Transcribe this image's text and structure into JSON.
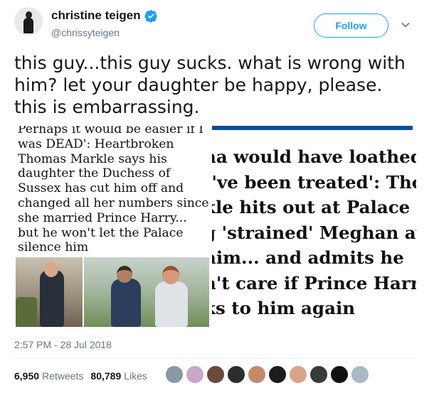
{
  "user": {
    "display_name": "christine teigen",
    "handle": "@chrissyteigen",
    "verified": true
  },
  "follow_label": "Follow",
  "tweet_text": "this guy...this guy sucks. what is wrong with him? let your daughter be happy, please. this is embarrassing.",
  "media": {
    "left_headline": "Perhaps it would be easier if I was DEAD': Heartbroken Thomas Markle says his daughter the Duchess of Sussex has cut him off and changed all her numbers since she married Prince Harry... but he won't let the Palace silence him",
    "right_headline_lines": [
      "na would have loathed t",
      "I've been treated': Thor",
      "kle hits out at Palace fo",
      "g 'strained' Meghan av",
      " him... and admits he",
      "n't care if Prince Harry",
      "ks to him again"
    ]
  },
  "timestamp": "2:57 PM - 28 Jul 2018",
  "stats": {
    "retweets_count": "6,950",
    "retweets_label": "Retweets",
    "likes_count": "80,789",
    "likes_label": "Likes"
  },
  "likers": [
    "#8899a6",
    "#c9a7c7",
    "#6b4a3a",
    "#2d2d2d",
    "#c48a6a",
    "#1c1c1c",
    "#d9a38a",
    "#3a3a3a",
    "#111111",
    "#aab8c2"
  ],
  "colors": {
    "accent": "#1da1f2",
    "secondary_text": "#657786",
    "blue_bar": "#0b4ea2"
  }
}
